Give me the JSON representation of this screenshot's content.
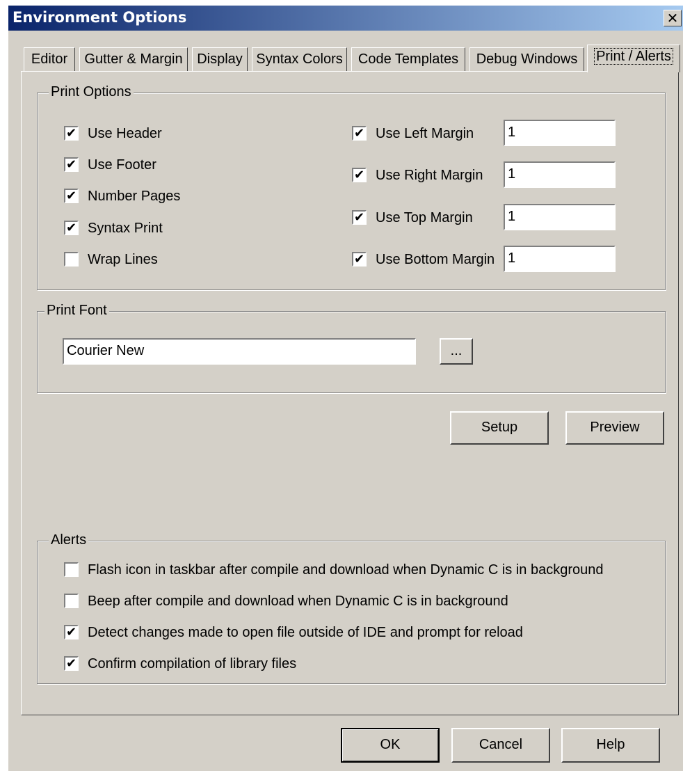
{
  "window": {
    "title": "Environment Options",
    "close_label": "✕"
  },
  "tabs": [
    "Editor",
    "Gutter & Margin",
    "Display",
    "Syntax Colors",
    "Code Templates",
    "Debug Windows",
    "Print / Alerts"
  ],
  "print_options": {
    "legend": "Print Options",
    "left": [
      {
        "label": "Use Header",
        "checked": true
      },
      {
        "label": "Use Footer",
        "checked": true
      },
      {
        "label": "Number Pages",
        "checked": true
      },
      {
        "label": "Syntax Print",
        "checked": true
      },
      {
        "label": "Wrap Lines",
        "checked": false
      }
    ],
    "right": [
      {
        "label": "Use Left Margin",
        "checked": true,
        "value": "1"
      },
      {
        "label": "Use Right Margin",
        "checked": true,
        "value": "1"
      },
      {
        "label": "Use Top Margin",
        "checked": true,
        "value": "1"
      },
      {
        "label": "Use Bottom Margin",
        "checked": true,
        "value": "1"
      }
    ]
  },
  "print_font": {
    "legend": "Print Font",
    "value": "Courier New",
    "browse_label": "..."
  },
  "setup_label": "Setup",
  "preview_label": "Preview",
  "alerts": {
    "legend": "Alerts",
    "items": [
      {
        "label": "Flash icon in taskbar after compile and download when Dynamic C is in background",
        "checked": false
      },
      {
        "label": "Beep after compile and download when Dynamic C is in background",
        "checked": false
      },
      {
        "label": "Detect changes made to open file outside of IDE and prompt for reload",
        "checked": true
      },
      {
        "label": "Confirm compilation of library files",
        "checked": true
      }
    ]
  },
  "footer": {
    "ok_label": "OK",
    "cancel_label": "Cancel",
    "help_label": "Help"
  },
  "check_glyph": "✔"
}
